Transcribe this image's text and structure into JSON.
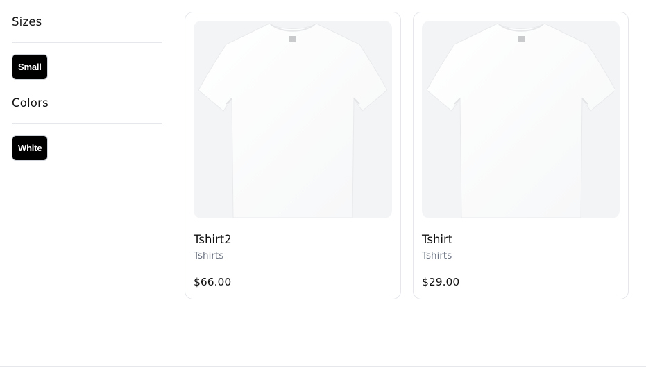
{
  "filters": {
    "sizes": {
      "title": "Sizes",
      "options": [
        "Small"
      ],
      "selected": "Small"
    },
    "colors": {
      "title": "Colors",
      "options": [
        "White"
      ],
      "selected": "White"
    }
  },
  "products": [
    {
      "name": "Tshirt2",
      "category": "Tshirts",
      "price": "$66.00",
      "image_icon": "white-tshirt-image"
    },
    {
      "name": "Tshirt",
      "category": "Tshirts",
      "price": "$29.00",
      "image_icon": "white-tshirt-image"
    }
  ],
  "colors": {
    "chip_bg": "#000000",
    "chip_text": "#ffffff",
    "image_bg": "#f3f4f6",
    "muted_text": "#6b7280",
    "border": "#e5e7eb"
  }
}
